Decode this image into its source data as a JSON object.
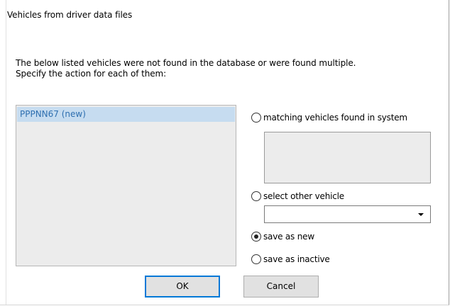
{
  "dialog": {
    "title": "Vehicles from driver data files",
    "message_line1": "The below listed vehicles were not found in the database or were found multiple.",
    "message_line2": "Specify the action for each of them:"
  },
  "vehicle_list": {
    "items": [
      {
        "label": "PPPNN67 (new)",
        "selected": true
      }
    ]
  },
  "options": {
    "matching": {
      "label": "matching vehicles found in system",
      "checked": false
    },
    "select_other": {
      "label": "select other vehicle",
      "checked": false
    },
    "save_new": {
      "label": "save as new",
      "checked": true
    },
    "save_inactive": {
      "label": "save as inactive",
      "checked": false
    }
  },
  "select_other_combo": {
    "value": ""
  },
  "buttons": {
    "ok": "OK",
    "cancel": "Cancel"
  }
}
